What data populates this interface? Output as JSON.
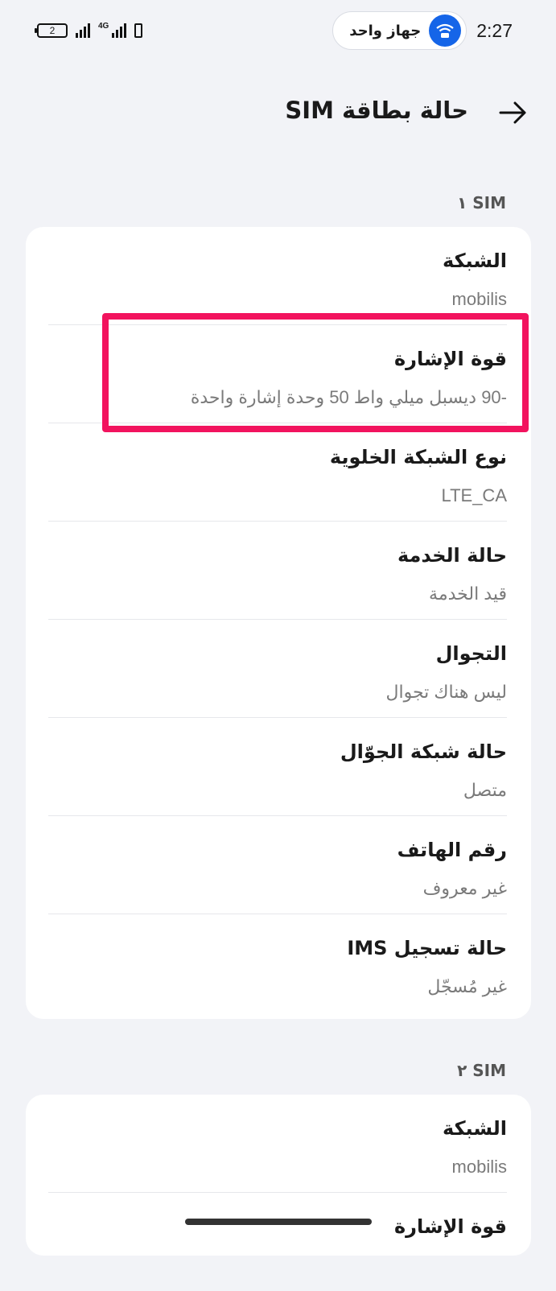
{
  "status_bar": {
    "battery_level": "2",
    "network_type": "4G",
    "hotspot_label": "جهاز واحد",
    "time": "2:27"
  },
  "header": {
    "title": "حالة بطاقة SIM",
    "back_icon": "arrow-right-icon"
  },
  "sim1": {
    "label": "SIM ١",
    "rows": [
      {
        "title": "الشبكة",
        "value": "mobilis"
      },
      {
        "title": "قوة الإشارة",
        "value": "-90 ديسبل ميلي واط 50 وحدة إشارة واحدة"
      },
      {
        "title": "نوع الشبكة الخلوية",
        "value": "LTE_CA"
      },
      {
        "title": "حالة الخدمة",
        "value": "قيد الخدمة"
      },
      {
        "title": "التجوال",
        "value": "ليس هناك تجوال"
      },
      {
        "title": "حالة شبكة الجوّال",
        "value": "متصل"
      },
      {
        "title": "رقم الهاتف",
        "value": "غير معروف"
      },
      {
        "title": "حالة تسجيل IMS",
        "value": "غير مُسجّل"
      }
    ]
  },
  "sim2": {
    "label": "SIM ٢",
    "rows": [
      {
        "title": "الشبكة",
        "value": "mobilis"
      },
      {
        "title": "قوة الإشارة",
        "value": ""
      }
    ]
  },
  "colors": {
    "highlight": "#f2135e",
    "hotspot": "#1565e8",
    "background": "#f2f3f7"
  }
}
